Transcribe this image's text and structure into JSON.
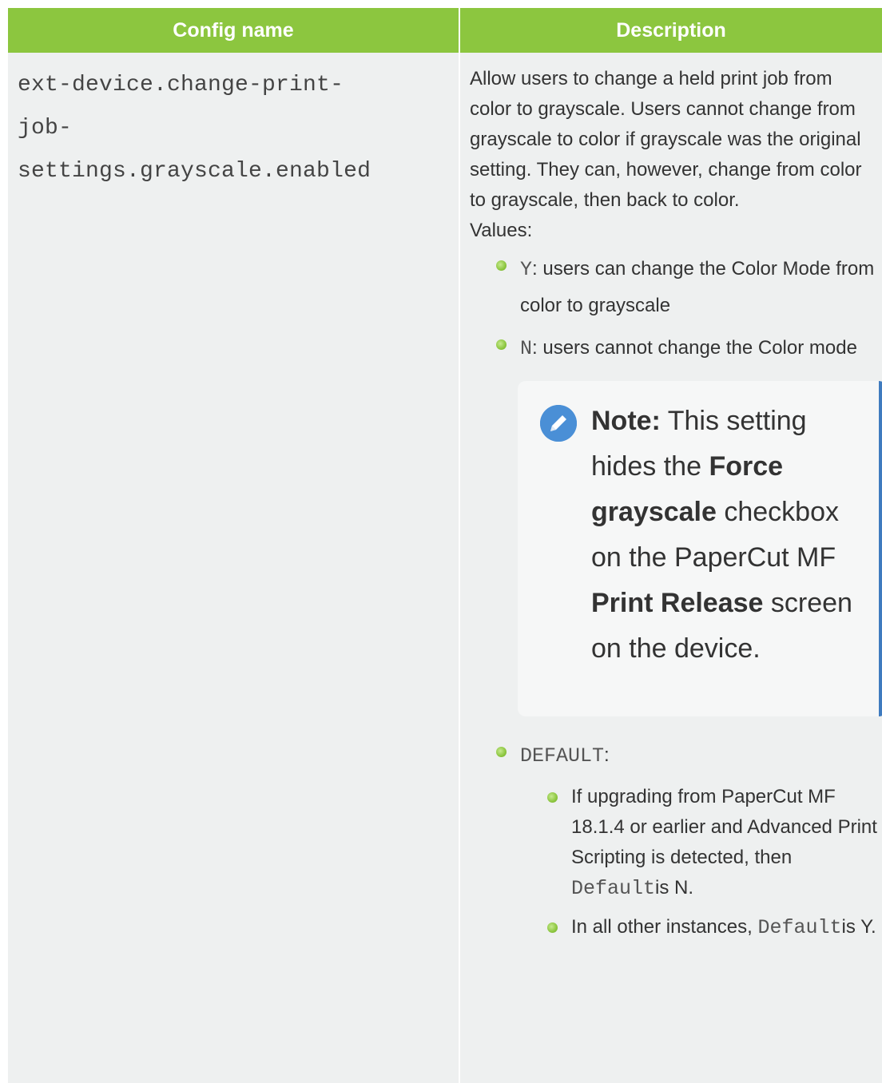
{
  "table": {
    "headers": {
      "config_name": "Config name",
      "description": "Description"
    },
    "row": {
      "config_lines": [
        "ext-device.change-print-",
        "job-",
        "settings.grayscale.enabled"
      ],
      "description_paragraph": "Allow users to change a held print job from color to grayscale. Users cannot change from grayscale to color if grayscale was the original setting. They can, however, change from color to grayscale, then back to color.",
      "values_label": "Values:",
      "values": [
        {
          "code": "Y",
          "text": ": users can change the Color Mode from color to grayscale"
        },
        {
          "code": "N",
          "text": ": users cannot change the Color mode"
        }
      ],
      "note": {
        "label": "Note:",
        "text_1": " This setting hides the ",
        "bold_1": "Force grayscale",
        "text_2": " checkbox on the PaperCut MF ",
        "bold_2": "Print Release",
        "text_3": " screen on the device."
      },
      "default_item": {
        "code": "DEFAULT",
        "suffix": ":",
        "sub_items": [
          {
            "text": "If upgrading from PaperCut MF 18.1.4 or earlier and Advanced Print Scripting is detected, then ",
            "code": "Default",
            "tail": "is N."
          },
          {
            "text": "In all other instances, ",
            "code": "Default",
            "tail": "is Y."
          }
        ]
      }
    }
  },
  "colors": {
    "header_bg": "#8cc63f",
    "body_bg": "#eef0f0",
    "note_accent": "#3f7bbf",
    "bullet": "#8cc63f"
  },
  "icons": {
    "note_icon": "pencil-icon",
    "bullet_icon": "green-dot-icon"
  }
}
